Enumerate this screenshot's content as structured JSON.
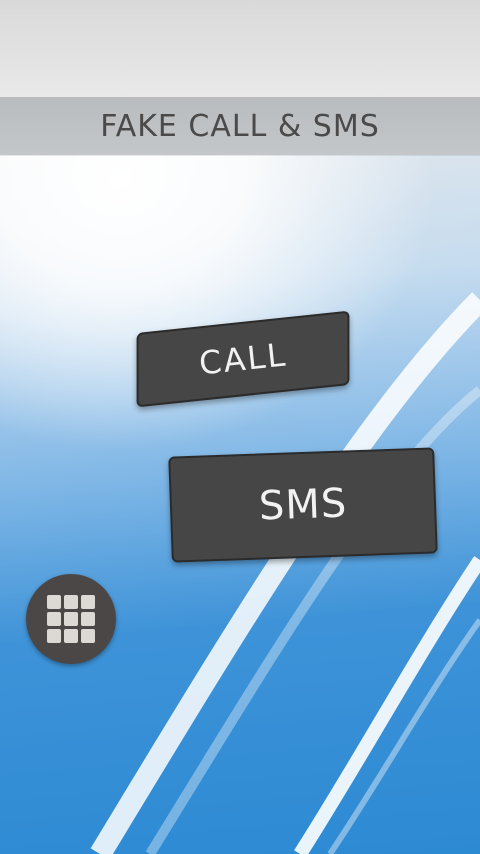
{
  "header": {
    "title": "FAKE CALL & SMS"
  },
  "buttons": {
    "call_label": "CALL",
    "sms_label": "SMS"
  },
  "apps_button": {
    "icon": "grid-apps-icon"
  },
  "colors": {
    "button_bg": "#464646",
    "title_bar_bg": "#c1c4c7",
    "background_blue": "#2c8ad3"
  }
}
